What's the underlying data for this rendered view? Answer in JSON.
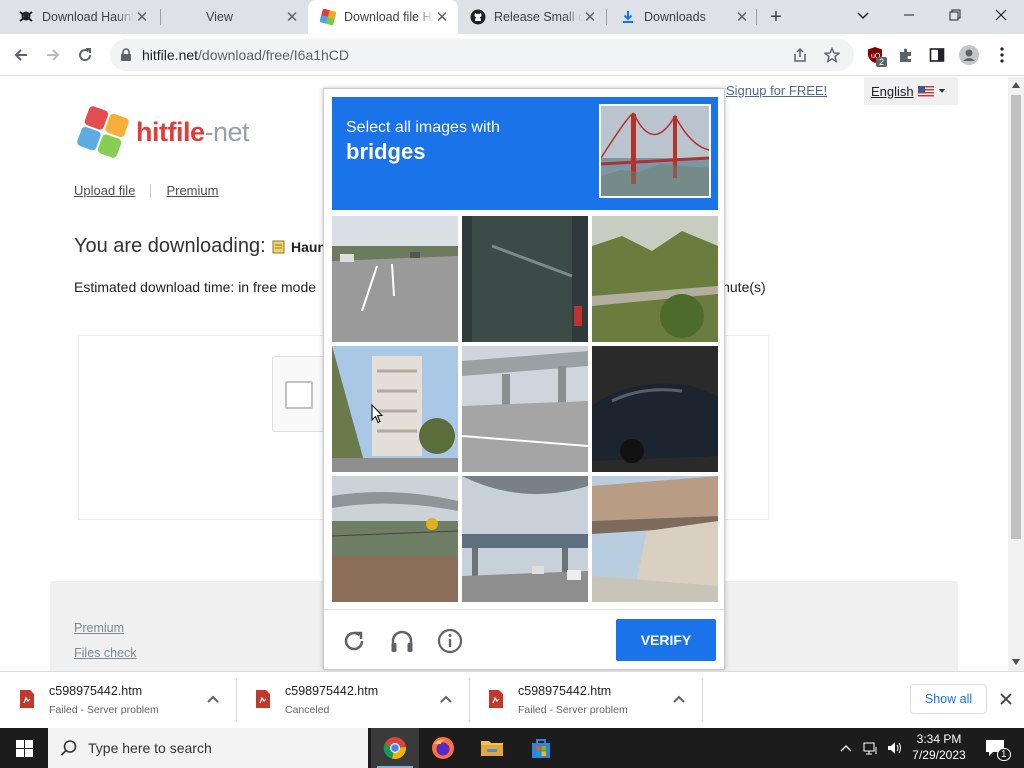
{
  "tabs": [
    {
      "title": "Download Haunted Hou",
      "icon": "pirate-skull-icon",
      "active": false
    },
    {
      "title": "View",
      "icon": "",
      "active": false
    },
    {
      "title": "Download file Haunt",
      "icon": "hitfile-logo-icon",
      "active": true
    },
    {
      "title": "Release Small d",
      "icon": "github-icon",
      "active": false
    },
    {
      "title": "Downloads",
      "icon": "download-icon",
      "active": false
    }
  ],
  "address": {
    "host": "hitfile.net",
    "path": "/download/free/I6a1hCD"
  },
  "extension_badge": "2",
  "site": {
    "logo_text": "hitfile",
    "logo_suffix": "-net",
    "signup_link": "Signup for FREE!",
    "language": "English",
    "nav": [
      "Upload file",
      "Premium"
    ],
    "downloading_label": "You are downloading:",
    "file_name_partial": "Haun",
    "estimated_left": "Estimated download time: in free mode",
    "estimated_right": "inute(s)",
    "footer_links": [
      "Premium",
      "Files check"
    ]
  },
  "captcha": {
    "instruction_line1": "Select all images with",
    "instruction_target": "bridges",
    "verify_label": "VERIFY",
    "tiles": [
      "road",
      "dark-wall",
      "railway-greenery",
      "street-building-trees",
      "overpass-road",
      "car",
      "overpass-fence",
      "highway-bridge",
      "bridge-underside"
    ]
  },
  "downloads": [
    {
      "name": "c598975442.htm",
      "status": "Failed - Server problem"
    },
    {
      "name": "c598975442.htm",
      "status": "Canceled"
    },
    {
      "name": "c598975442.htm",
      "status": "Failed - Server problem"
    }
  ],
  "show_all_label": "Show all",
  "taskbar": {
    "search_placeholder": "Type here to search",
    "time": "3:34 PM",
    "date": "7/29/2023",
    "notification_count": "1"
  },
  "colors": {
    "accent_blue": "#1a73e8",
    "hitfile_red": "#e23b3b",
    "taskbar": "#1c1c1c"
  }
}
